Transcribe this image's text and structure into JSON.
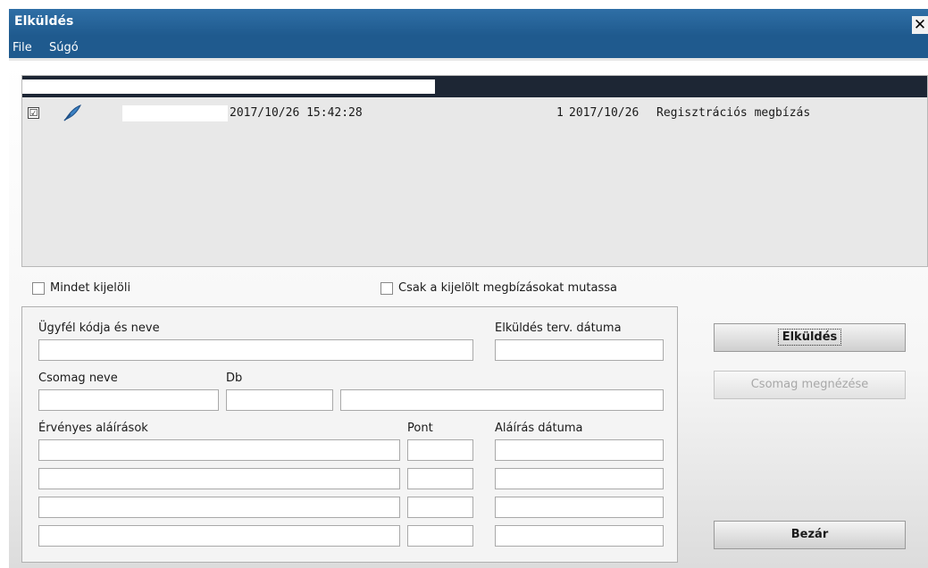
{
  "window": {
    "title": "Elküldés",
    "close_label": "✕"
  },
  "menu": [
    "File",
    "Súgó"
  ],
  "list": {
    "rows": [
      {
        "checked": true,
        "checkmark": "☑",
        "icon": "quill-icon",
        "datetime": "2017/10/26 15:42:28",
        "count": "1",
        "date": "2017/10/26",
        "type": "Regisztrációs megbízás"
      }
    ]
  },
  "options": {
    "select_all_label": "Mindet kijelöli",
    "show_selected_label": "Csak a kijelölt megbízásokat mutassa"
  },
  "form": {
    "client_label": "Ügyfél kódja és neve",
    "planned_date_label": "Elküldés terv. dátuma",
    "package_name_label": "Csomag neve",
    "count_label": "Db",
    "valid_signatures_label": "Érvényes aláírások",
    "score_label": "Pont",
    "signature_date_label": "Aláírás dátuma"
  },
  "buttons": {
    "send": "Elküldés",
    "view_package": "Csomag megnézése",
    "close": "Bezár"
  },
  "colors": {
    "titlebar": "#1f5a8e",
    "list_header": "#1d2634",
    "list_bg": "#e8e8e8"
  }
}
